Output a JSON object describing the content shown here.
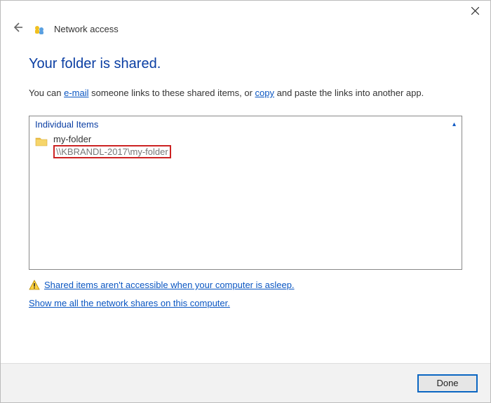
{
  "window": {
    "title": "Network access"
  },
  "page": {
    "heading": "Your folder is shared.",
    "desc_before": "You can ",
    "desc_link_email": "e-mail",
    "desc_mid": " someone links to these shared items, or ",
    "desc_link_copy": "copy",
    "desc_after": " and paste the links into another app."
  },
  "items_section": {
    "header": "Individual Items",
    "folder_name": "my-folder",
    "folder_path": "\\\\KBRANDL-2017\\my-folder"
  },
  "footer": {
    "sleep_warning": "Shared items aren't accessible when your computer is asleep.",
    "show_all": "Show me all the network shares on this computer."
  },
  "buttons": {
    "done": "Done"
  }
}
